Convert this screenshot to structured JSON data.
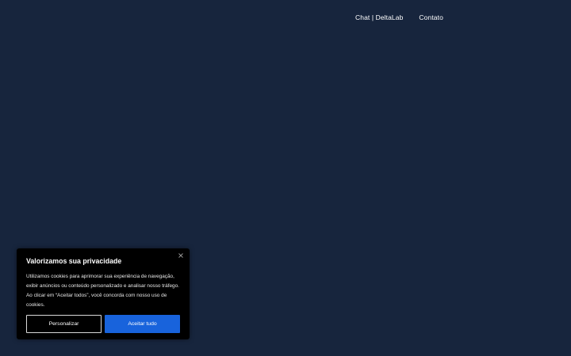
{
  "nav": {
    "items": [
      {
        "label": "Chat | DeltaLab"
      },
      {
        "label": "Contato"
      }
    ]
  },
  "cookie_banner": {
    "title": "Valorizamos sua privacidade",
    "body": "Utilizamos cookies para aprimorar sua experiência de navegação, exibir anúncios ou conteúdo personalizado e analisar nosso tráfego. Ao clicar em “Aceitar todos”, você concorda com nosso uso de cookies.",
    "customize_label": "Personalizar",
    "accept_label": "Aceitar tudo",
    "close_icon": "close-icon"
  },
  "colors": {
    "background": "#17253d",
    "banner_bg": "#000000",
    "accent": "#1863dc",
    "text": "#ffffff"
  }
}
